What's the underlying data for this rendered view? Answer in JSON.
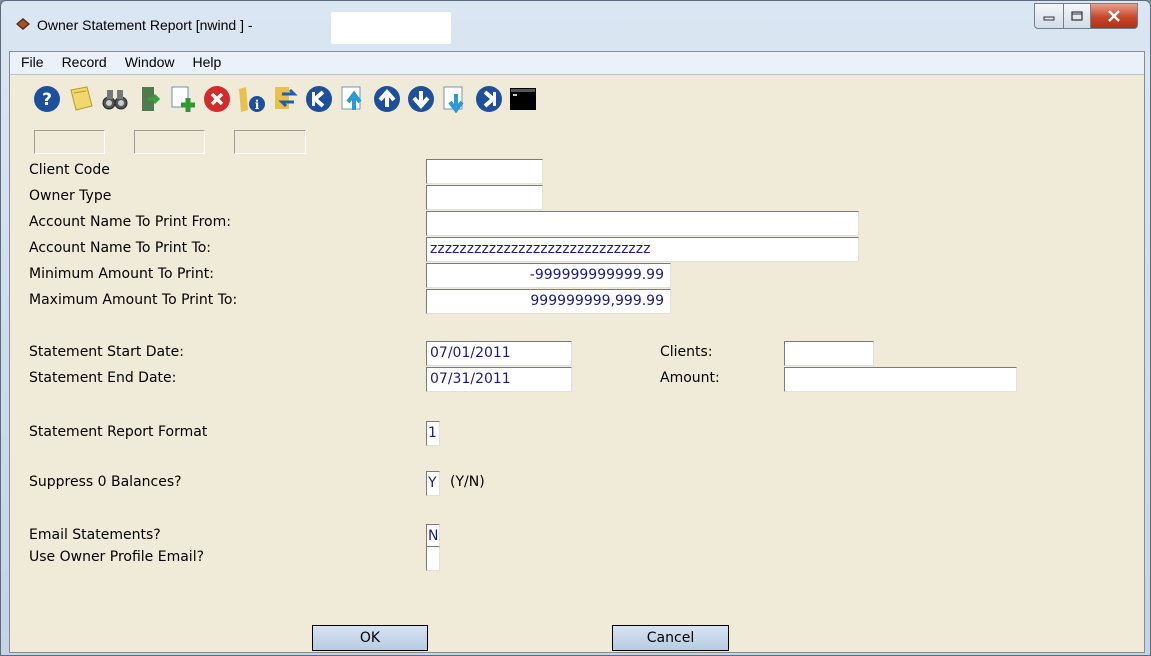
{
  "window": {
    "title": "Owner Statement Report [nwind  ] -"
  },
  "menu": {
    "items": [
      "File",
      "Record",
      "Window",
      "Help"
    ]
  },
  "toolbar": {
    "icons": [
      "help-icon",
      "note-icon",
      "binoculars-icon",
      "exit-icon",
      "add-icon",
      "delete-icon",
      "info-folder-icon",
      "refresh-icon",
      "first-record-icon",
      "prev-page-icon",
      "up-icon",
      "down-icon",
      "next-page-icon",
      "last-record-icon",
      "terminal-icon"
    ]
  },
  "form": {
    "client_code": {
      "label": "Client Code",
      "value": ""
    },
    "owner_type": {
      "label": "Owner Type",
      "value": ""
    },
    "acct_from": {
      "label": "Account Name To Print From:",
      "value": ""
    },
    "acct_to": {
      "label": "Account Name To Print To:",
      "value": "zzzzzzzzzzzzzzzzzzzzzzzzzzzzzz"
    },
    "min_amount": {
      "label": "Minimum Amount To Print:",
      "value": "-999999999999.99"
    },
    "max_amount": {
      "label": "Maximum Amount To Print To:",
      "value": "999999999,999.99"
    },
    "start_date": {
      "label": "Statement Start Date:",
      "value": "07/01/2011"
    },
    "end_date": {
      "label": "Statement End Date:",
      "value": "07/31/2011"
    },
    "clients": {
      "label": "Clients:",
      "value": ""
    },
    "amount": {
      "label": "Amount:",
      "value": ""
    },
    "report_format": {
      "label": "Statement Report Format",
      "value": "1"
    },
    "suppress": {
      "label": "Suppress 0 Balances?",
      "value": "Y",
      "hint": "(Y/N)"
    },
    "email": {
      "label": "Email Statements?",
      "value": "N"
    },
    "use_profile_email": {
      "label": "Use Owner Profile Email?",
      "value": ""
    }
  },
  "buttons": {
    "ok": "OK",
    "cancel": "Cancel"
  },
  "colors": {
    "field_text": "#1a1a8a",
    "client_bg": "#efebd8",
    "button_bg": "#b7cbe3"
  }
}
